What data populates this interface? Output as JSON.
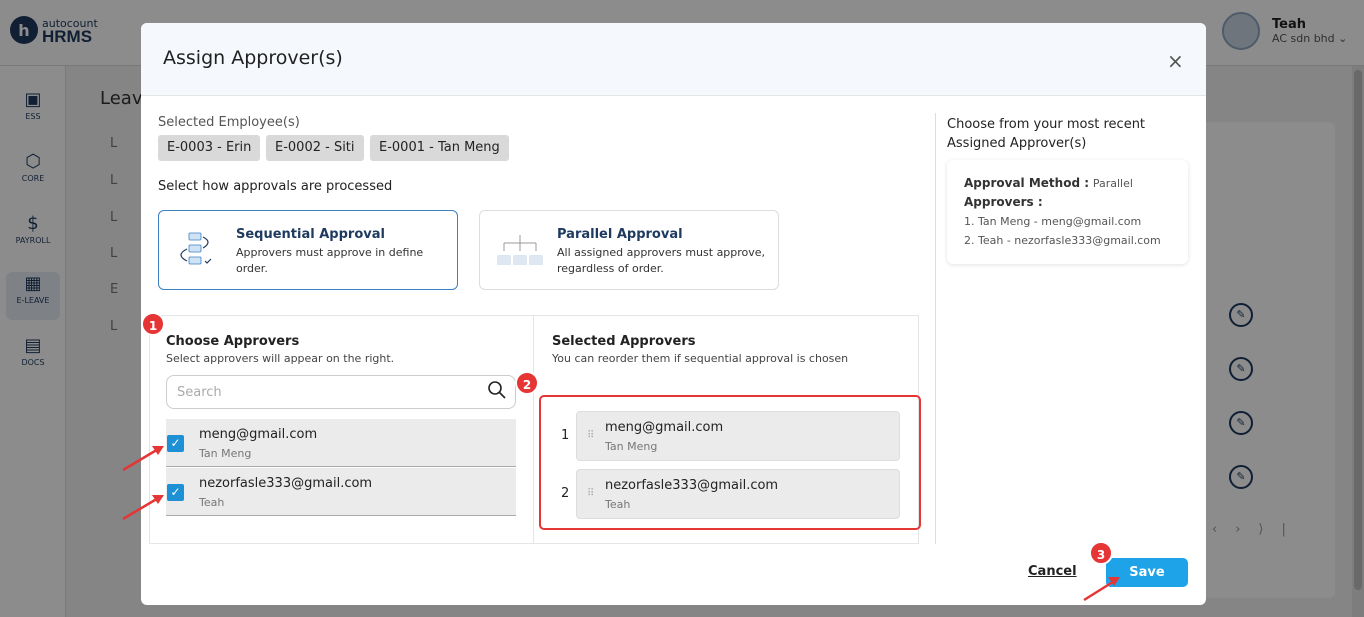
{
  "app": {
    "logo_letter": "h",
    "logo_small": "autocount",
    "logo_big": "HRMS"
  },
  "user": {
    "name": "Teah",
    "company": "AC sdn bhd"
  },
  "sidenav": [
    {
      "label": "ESS",
      "icon": "id-card-icon"
    },
    {
      "label": "CORE",
      "icon": "cube-icon"
    },
    {
      "label": "PAYROLL",
      "icon": "dollar-icon"
    },
    {
      "label": "E-LEAVE",
      "icon": "calendar-icon"
    },
    {
      "label": "DOCS",
      "icon": "document-chart-icon"
    }
  ],
  "background": {
    "page_title": "Leave",
    "list_items": [
      "L",
      "L",
      "L",
      "L",
      "E",
      "L"
    ]
  },
  "modal": {
    "title": "Assign Approver(s)",
    "close": "×",
    "selected_employees_label": "Selected Employee(s)",
    "employees": [
      "E-0003 - Erin",
      "E-0002 - Siti",
      "E-0001 - Tan Meng"
    ],
    "process_label": "Select how approvals are processed",
    "sequential": {
      "title": "Sequential Approval",
      "desc": "Approvers must approve in define order."
    },
    "parallel": {
      "title": "Parallel Approval",
      "desc": "All assigned approvers must approve, regardless of order."
    },
    "choose": {
      "title": "Choose Approvers",
      "subtitle": "Select approvers will appear on the right.",
      "search_placeholder": "Search",
      "items": [
        {
          "email": "meng@gmail.com",
          "name": "Tan Meng",
          "checked": true
        },
        {
          "email": "nezorfasle333@gmail.com",
          "name": "Teah",
          "checked": true
        }
      ]
    },
    "selected": {
      "title": "Selected Approvers",
      "subtitle": "You can reorder them if sequential approval is chosen",
      "items": [
        {
          "order": "1",
          "email": "meng@gmail.com",
          "name": "Tan Meng"
        },
        {
          "order": "2",
          "email": "nezorfasle333@gmail.com",
          "name": "Teah"
        }
      ]
    },
    "recent": {
      "title": "Choose from your most recent Assigned Approver(s)",
      "method_label": "Approval Method :",
      "method_value": "Parallel",
      "approvers_label": "Approvers :",
      "approvers": [
        "1. Tan Meng - meng@gmail.com",
        "2. Teah - nezorfasle333@gmail.com"
      ]
    },
    "cancel_label": "Cancel",
    "save_label": "Save"
  },
  "annotations": {
    "badges": [
      "1",
      "2",
      "3"
    ],
    "highlight_color": "#e53535"
  }
}
